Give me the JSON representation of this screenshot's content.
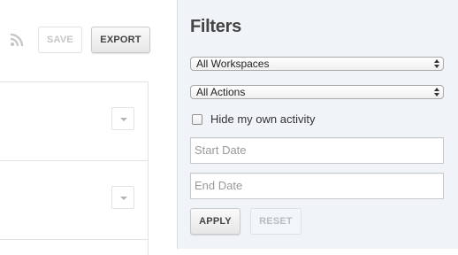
{
  "toolbar": {
    "rss_icon": "rss-icon",
    "save_label": "SAVE",
    "export_label": "EXPORT"
  },
  "activity_list": {
    "rows": [
      {
        "menu_icon": "chevron-down-icon"
      },
      {
        "menu_icon": "chevron-down-icon"
      }
    ]
  },
  "filters": {
    "title": "Filters",
    "workspace_select": {
      "value": "All Workspaces"
    },
    "action_select": {
      "value": "All Actions"
    },
    "hide_own_activity": {
      "label": "Hide my own activity",
      "checked": false
    },
    "start_date": {
      "placeholder": "Start Date",
      "value": ""
    },
    "end_date": {
      "placeholder": "End Date",
      "value": ""
    },
    "apply_label": "APPLY",
    "reset_label": "RESET"
  },
  "colors": {
    "panel_background": "#f0f4f8",
    "disabled_text": "#c6c6c6",
    "title_text": "#444444"
  }
}
